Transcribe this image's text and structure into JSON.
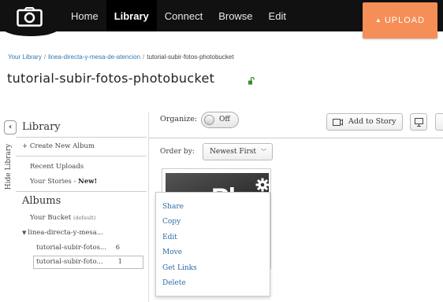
{
  "topbar": {
    "nav": [
      {
        "label": "Home",
        "active": false
      },
      {
        "label": "Library",
        "active": true
      },
      {
        "label": "Connect",
        "active": false
      },
      {
        "label": "Browse",
        "active": false
      },
      {
        "label": "Edit",
        "active": false
      }
    ],
    "upload_label": "UPLOAD"
  },
  "breadcrumb": {
    "items": [
      "Your Library",
      "linea-directa-y-mesa-de-atencion",
      "tutorial-subir-fotos-photobucket"
    ]
  },
  "page": {
    "title": "tutorial-subir-fotos-photobucket"
  },
  "sidebar": {
    "hide_label": "Hide Library",
    "library_heading": "Library",
    "create_album": "+ Create New Album",
    "recent_uploads": "Recent Uploads",
    "your_stories": "Your Stories - ",
    "your_stories_new": "New!",
    "albums_heading": "Albums",
    "your_bucket": "Your Bucket ",
    "your_bucket_tag": "(default)",
    "parent_album": "linea-directa-y-mesa...",
    "albums": [
      {
        "name": "tutorial-subir-fotos...",
        "count": "6",
        "selected": false
      },
      {
        "name": "tutorial-subir-foto...",
        "count": "1",
        "selected": true
      }
    ]
  },
  "main": {
    "organize_label": "Organize:",
    "organize_state": "Off",
    "add_to_story": "Add to Story",
    "order_by_label": "Order by:",
    "order_by_value": "Newest First"
  },
  "photo": {
    "thumb_text": "Ph"
  },
  "context_menu": {
    "items": [
      "Share",
      "Copy",
      "Edit",
      "Move",
      "Get Links",
      "Delete"
    ]
  },
  "colors": {
    "topbar": "#111111",
    "upload_accent": "#f68e57",
    "link": "#2f78b5"
  }
}
